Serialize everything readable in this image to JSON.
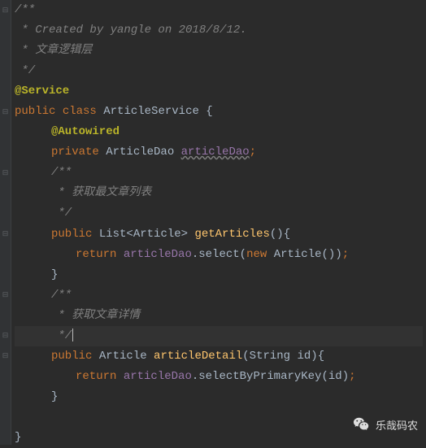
{
  "code": {
    "c1": "/**",
    "c2": " * Created by yangle on 2018/8/12.",
    "c3": " * 文章逻辑层",
    "c4": " */",
    "anno1": "@Service",
    "kw_public": "public",
    "kw_class": "class",
    "cls": "ArticleService",
    "brace_open": "{",
    "anno2": "@Autowired",
    "kw_private": "private",
    "type_dao": "ArticleDao",
    "field_dao": "articleDao",
    "semi": ";",
    "c5": "/**",
    "c6": " * 获取最文章列表",
    "c7": " */",
    "type_list": "List<Article>",
    "m_getArticles": "getArticles",
    "paren_empty": "()",
    "kw_return": "return",
    "dot": ".",
    "m_select": "select",
    "paren_open": "(",
    "kw_new": "new",
    "ctor": "Article()",
    "paren_close": ")",
    "brace_close": "}",
    "c8": "/**",
    "c9": " * 获取文章详情",
    "c10": " */",
    "type_article": "Article",
    "m_articleDetail": "articleDetail",
    "param_string": "(String id)",
    "m_selectByPk": "selectByPrimaryKey",
    "arg_id": "(id)"
  },
  "watermark": {
    "text": "乐哉码农"
  }
}
